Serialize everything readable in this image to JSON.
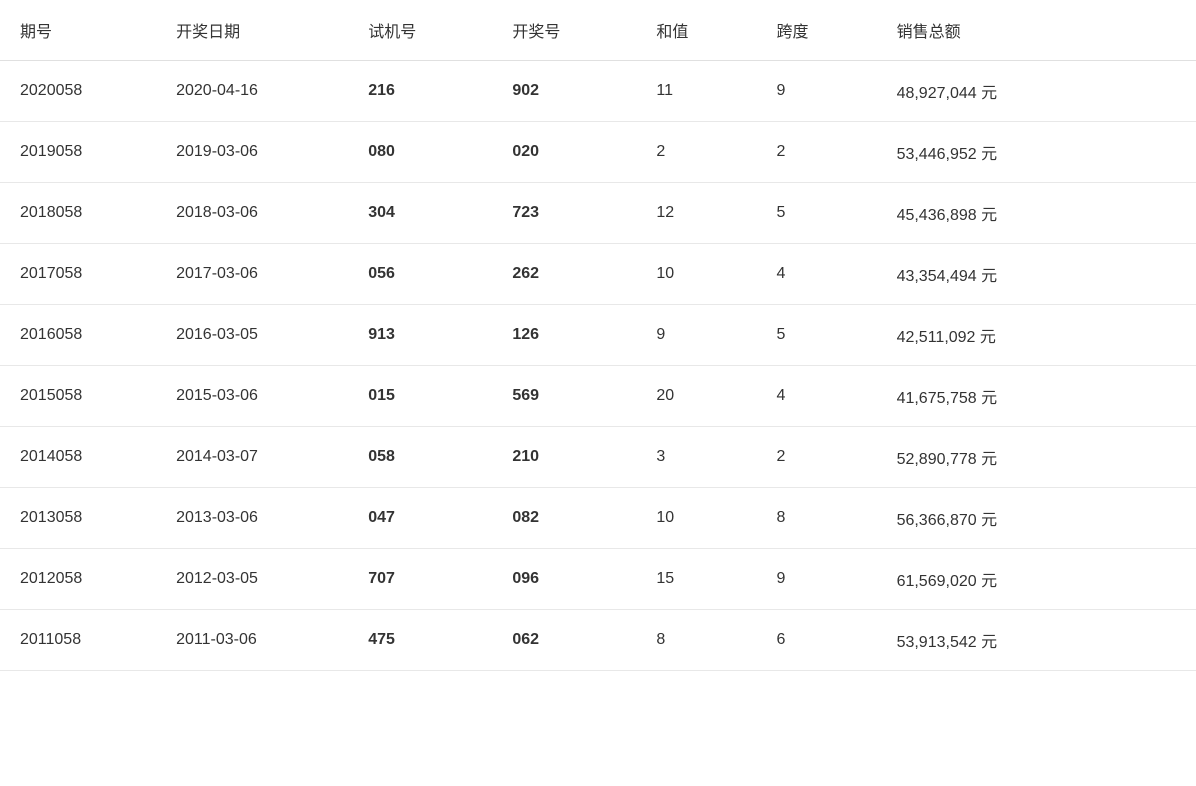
{
  "table": {
    "headers": [
      "期号",
      "开奖日期",
      "试机号",
      "开奖号",
      "和值",
      "跨度",
      "销售总额"
    ],
    "rows": [
      {
        "qihao": "2020058",
        "date": "2020-04-16",
        "shiji": "216",
        "kaijang": "902",
        "hezhi": "11",
        "kuadu": "9",
        "sales": "48,927,044 元"
      },
      {
        "qihao": "2019058",
        "date": "2019-03-06",
        "shiji": "080",
        "kaijang": "020",
        "hezhi": "2",
        "kuadu": "2",
        "sales": "53,446,952 元"
      },
      {
        "qihao": "2018058",
        "date": "2018-03-06",
        "shiji": "304",
        "kaijang": "723",
        "hezhi": "12",
        "kuadu": "5",
        "sales": "45,436,898 元"
      },
      {
        "qihao": "2017058",
        "date": "2017-03-06",
        "shiji": "056",
        "kaijang": "262",
        "hezhi": "10",
        "kuadu": "4",
        "sales": "43,354,494 元"
      },
      {
        "qihao": "2016058",
        "date": "2016-03-05",
        "shiji": "913",
        "kaijang": "126",
        "hezhi": "9",
        "kuadu": "5",
        "sales": "42,511,092 元"
      },
      {
        "qihao": "2015058",
        "date": "2015-03-06",
        "shiji": "015",
        "kaijang": "569",
        "hezhi": "20",
        "kuadu": "4",
        "sales": "41,675,758 元"
      },
      {
        "qihao": "2014058",
        "date": "2014-03-07",
        "shiji": "058",
        "kaijang": "210",
        "hezhi": "3",
        "kuadu": "2",
        "sales": "52,890,778 元"
      },
      {
        "qihao": "2013058",
        "date": "2013-03-06",
        "shiji": "047",
        "kaijang": "082",
        "hezhi": "10",
        "kuadu": "8",
        "sales": "56,366,870 元"
      },
      {
        "qihao": "2012058",
        "date": "2012-03-05",
        "shiji": "707",
        "kaijang": "096",
        "hezhi": "15",
        "kuadu": "9",
        "sales": "61,569,020 元"
      },
      {
        "qihao": "2011058",
        "date": "2011-03-06",
        "shiji": "475",
        "kaijang": "062",
        "hezhi": "8",
        "kuadu": "6",
        "sales": "53,913,542 元"
      }
    ]
  }
}
